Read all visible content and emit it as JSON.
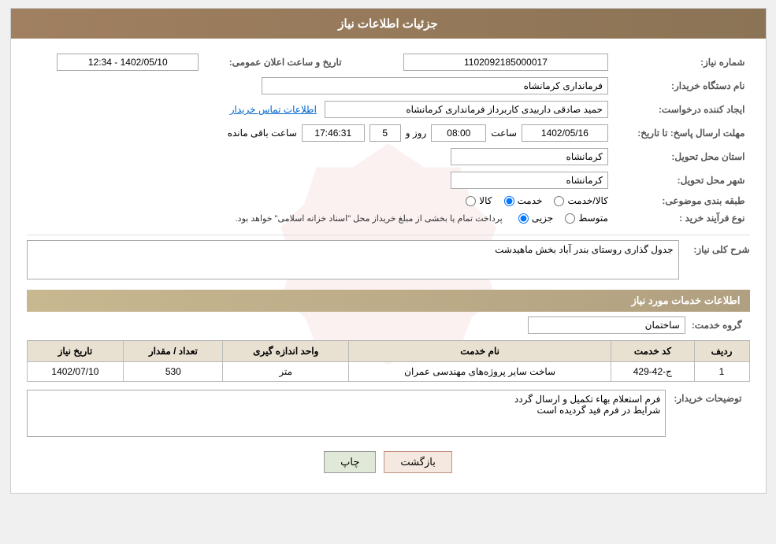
{
  "page": {
    "title": "جزئیات اطلاعات نیاز"
  },
  "header": {
    "print_btn": "چاپ",
    "back_btn": "بازگشت"
  },
  "fields": {
    "need_number_label": "شماره نیاز:",
    "need_number_value": "1102092185000017",
    "buyer_org_label": "نام دستگاه خریدار:",
    "buyer_org_value": "فرمانداری کرمانشاه",
    "creator_label": "ایجاد کننده درخواست:",
    "creator_value": "حمید صادقی داربیدی کاربرداز فرمانداری کرمانشاه",
    "contact_link": "اطلاعات تماس خریدار",
    "announce_datetime_label": "تاریخ و ساعت اعلان عمومی:",
    "announce_datetime_value": "1402/05/10 - 12:34",
    "deadline_label": "مهلت ارسال پاسخ: تا تاریخ:",
    "deadline_date": "1402/05/16",
    "deadline_time_label": "ساعت",
    "deadline_time": "08:00",
    "deadline_days_label": "روز و",
    "deadline_days": "5",
    "deadline_remaining_label": "ساعت باقی مانده",
    "deadline_remaining": "17:46:31",
    "province_label": "استان محل تحویل:",
    "province_value": "کرمانشاه",
    "city_label": "شهر محل تحویل:",
    "city_value": "کرمانشاه",
    "category_label": "طبقه بندی موضوعی:",
    "category_kala": "کالا",
    "category_khadamat": "خدمت",
    "category_kala_khadamat": "کالا/خدمت",
    "category_selected": "khadamat",
    "purchase_type_label": "نوع فرآیند خرید :",
    "purchase_type_jozii": "جزیی",
    "purchase_type_motavasset": "متوسط",
    "purchase_type_note": "پرداخت تمام یا بخشی از مبلغ خریداز محل \"اسناد خزانه اسلامی\" خواهد بود.",
    "purchase_type_selected": "jozii"
  },
  "need_description": {
    "section_label": "شرح کلی نیاز:",
    "value": "جدول گذاری روستای بندر آباد بخش ماهیدشت"
  },
  "services_section": {
    "section_title": "اطلاعات خدمات مورد نیاز",
    "group_label": "گروه خدمت:",
    "group_value": "ساختمان",
    "table_headers": {
      "row_num": "ردیف",
      "service_code": "کد خدمت",
      "service_name": "نام خدمت",
      "unit": "واحد اندازه گیری",
      "quantity": "تعداد / مقدار",
      "need_date": "تاریخ نیاز"
    },
    "table_rows": [
      {
        "row_num": "1",
        "service_code": "ج-42-429",
        "service_name": "ساخت سایر پروژه‌های مهندسی عمران",
        "unit": "متر",
        "quantity": "530",
        "need_date": "1402/07/10"
      }
    ]
  },
  "buyer_notes": {
    "label": "توضیحات خریدار:",
    "line1": "فرم استعلام بهاء تکمیل و ارسال گردد",
    "line2": "شرایط در فرم فید گردیده است"
  }
}
